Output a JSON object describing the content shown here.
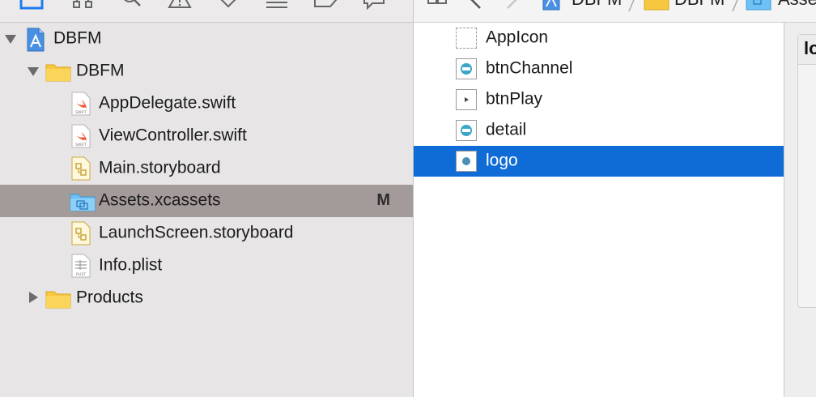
{
  "navigator": {
    "items": [
      {
        "label": "DBFM",
        "icon": "xcode-project-icon",
        "expanded": true
      },
      {
        "label": "DBFM",
        "icon": "folder-icon",
        "expanded": true
      },
      {
        "label": "AppDelegate.swift",
        "icon": "swift-file-icon"
      },
      {
        "label": "ViewController.swift",
        "icon": "swift-file-icon"
      },
      {
        "label": "Main.storyboard",
        "icon": "storyboard-file-icon"
      },
      {
        "label": "Assets.xcassets",
        "icon": "asset-catalog-icon",
        "status": "M",
        "selected": true
      },
      {
        "label": "LaunchScreen.storyboard",
        "icon": "storyboard-file-icon"
      },
      {
        "label": "Info.plist",
        "icon": "plist-file-icon"
      },
      {
        "label": "Products",
        "icon": "folder-icon",
        "expanded": false
      }
    ]
  },
  "jumpbar": {
    "crumbs": [
      "DBFM",
      "DBFM",
      "Asse"
    ]
  },
  "assets": {
    "items": [
      {
        "label": "AppIcon",
        "selected": false
      },
      {
        "label": "btnChannel",
        "selected": false
      },
      {
        "label": "btnPlay",
        "selected": false
      },
      {
        "label": "detail",
        "selected": false
      },
      {
        "label": "logo",
        "selected": true
      }
    ]
  },
  "detail": {
    "title": "lo"
  },
  "colors": {
    "selection_blue": "#0f6cd6",
    "navigator_selection": "#a39b99",
    "folder_yellow": "#f7c73f",
    "swift_orange": "#f0573a"
  }
}
